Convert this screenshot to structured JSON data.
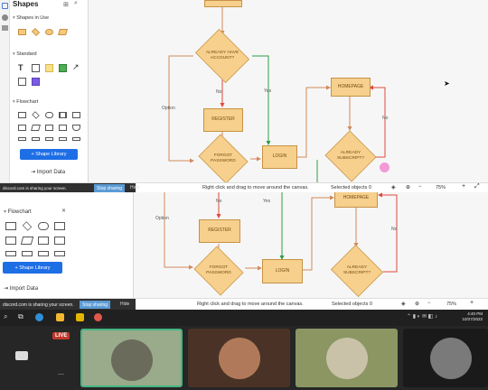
{
  "sidebar": {
    "title": "Shapes",
    "sections": [
      "Shapes in Use",
      "Standard",
      "Flowchart"
    ],
    "shape_library_button": "Shape Library",
    "import_label": "Import Data",
    "bottom_section": "Flowchart"
  },
  "diagram": {
    "nodes": {
      "already_have_account": "ALREADY HAVE\nACCOUNT?",
      "register": "REGISTER",
      "forgot_password": "FORGOT\nPASSWORD",
      "login": "LOGIN",
      "homepage": "HOMEPAGE",
      "already_subscript": "ALREADY\nSUBSCRIPT?"
    },
    "edge_labels": {
      "yes": "Yes",
      "no": "No",
      "option": "Option"
    }
  },
  "status": {
    "hint": "Right click and drag to move around the canvas.",
    "selected": "Selected objects",
    "selected_count": "0",
    "zoom": "75%"
  },
  "screenshare": {
    "message": "discord.com is sharing your screen.",
    "stop": "Stop sharing",
    "hide": "Hide"
  },
  "taskbar": {
    "time": "4:40 PM",
    "date": "10/27/2022"
  },
  "call": {
    "live_badge": "LIVE"
  },
  "colors": {
    "node_fill": "#f6d08c",
    "node_border": "#c69246",
    "yes_edge": "#2f9e44",
    "no_edge": "#e0483c",
    "flow_edge": "#d28a5a",
    "accent": "#1e6ee6"
  }
}
